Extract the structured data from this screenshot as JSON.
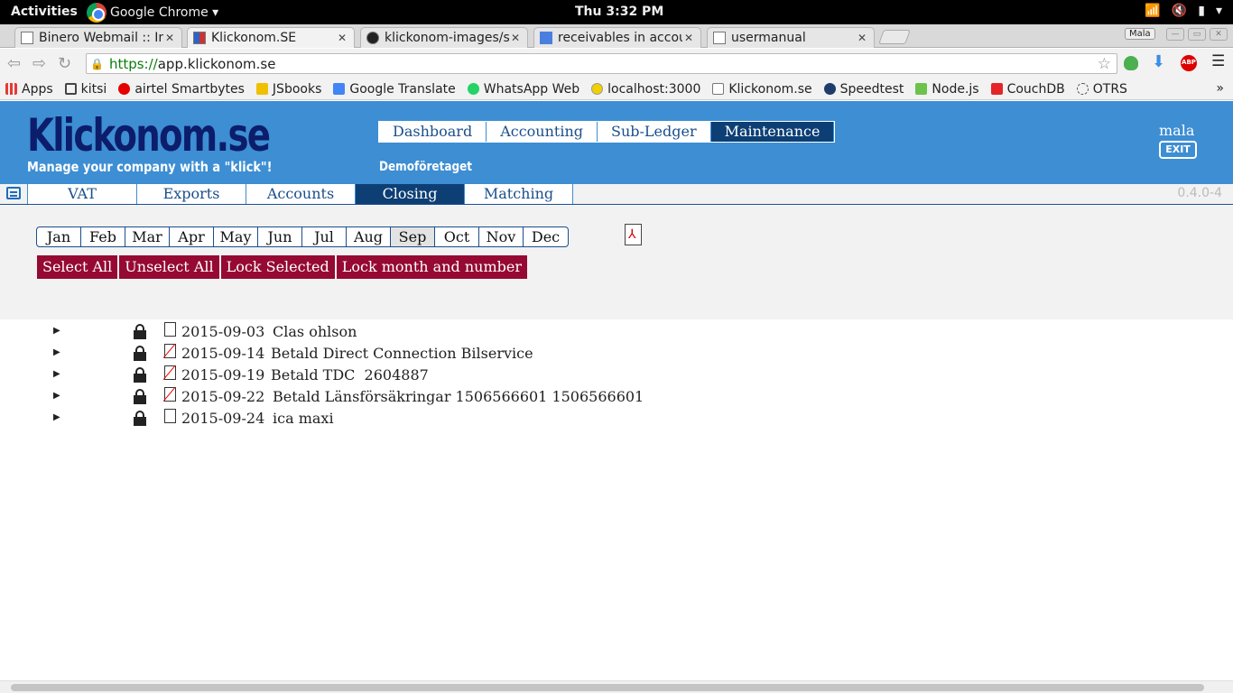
{
  "os": {
    "activities": "Activities",
    "app_menu": "Google Chrome ▾",
    "clock": "Thu  3:32 PM",
    "tray": [
      "wifi-icon",
      "volume-muted-icon",
      "battery-icon",
      "power-menu-icon"
    ]
  },
  "browser": {
    "tabs": [
      {
        "title": "Binero Webmail :: Int",
        "active": false
      },
      {
        "title": "Klickonom.SE",
        "active": true
      },
      {
        "title": "klickonom-images/su",
        "active": false
      },
      {
        "title": "receivables in accour",
        "active": false
      },
      {
        "title": "usermanual",
        "active": false
      }
    ],
    "tab_close": "✕",
    "profile_badge": "Mala",
    "url_scheme": "https://",
    "url_host": "app.klickonom.se",
    "extensions": [
      "evernote-icon",
      "download-icon",
      "adblock-plus-icon",
      "menu-icon"
    ],
    "adblock_label": "ABP",
    "bookmarks": [
      {
        "label": "Apps",
        "icon": "apps-grid-icon",
        "color": "#e53935"
      },
      {
        "label": "kitsi",
        "icon": "bookmark-icon",
        "color": "#444444"
      },
      {
        "label": "airtel Smartbytes",
        "icon": "airtel-icon",
        "color": "#e40000"
      },
      {
        "label": "JSbooks",
        "icon": "jsbooks-icon",
        "color": "#f0c000"
      },
      {
        "label": "Google Translate",
        "icon": "translate-icon",
        "color": "#4285f4"
      },
      {
        "label": "WhatsApp Web",
        "icon": "whatsapp-icon",
        "color": "#25d366"
      },
      {
        "label": "localhost:3000",
        "icon": "circle-icon",
        "color": "#f2d000"
      },
      {
        "label": "Klickonom.se",
        "icon": "page-icon",
        "color": "#ffffff"
      },
      {
        "label": "Speedtest",
        "icon": "speedtest-icon",
        "color": "#1f3c6b"
      },
      {
        "label": "Node.js",
        "icon": "nodejs-icon",
        "color": "#6cc24a"
      },
      {
        "label": "CouchDB",
        "icon": "couchdb-icon",
        "color": "#e42528"
      },
      {
        "label": "OTRS",
        "icon": "otrs-icon",
        "color": "#555555"
      }
    ],
    "bookmarks_more": "»"
  },
  "app": {
    "logo": "Klickonom.se",
    "tagline": "Manage your company with a \"klick\"!",
    "main_nav": [
      {
        "label": "Dashboard",
        "active": false
      },
      {
        "label": "Accounting",
        "active": false
      },
      {
        "label": "Sub-Ledger",
        "active": false
      },
      {
        "label": "Maintenance",
        "active": true
      }
    ],
    "company": "Demoföretaget",
    "user": "mala",
    "exit_label": "EXIT",
    "sub_nav": [
      {
        "label": "VAT",
        "active": false
      },
      {
        "label": "Exports",
        "active": false
      },
      {
        "label": "Accounts",
        "active": false
      },
      {
        "label": "Closing",
        "active": true
      },
      {
        "label": "Matching",
        "active": false
      }
    ],
    "version": "0.4.0-4",
    "months": [
      {
        "label": "Jan",
        "active": false
      },
      {
        "label": "Feb",
        "active": false
      },
      {
        "label": "Mar",
        "active": false
      },
      {
        "label": "Apr",
        "active": false
      },
      {
        "label": "May",
        "active": false
      },
      {
        "label": "Jun",
        "active": false
      },
      {
        "label": "Jul",
        "active": false
      },
      {
        "label": "Aug",
        "active": false
      },
      {
        "label": "Sep",
        "active": true
      },
      {
        "label": "Oct",
        "active": false
      },
      {
        "label": "Nov",
        "active": false
      },
      {
        "label": "Dec",
        "active": false
      }
    ],
    "actions": {
      "select_all": "Select All",
      "unselect_all": "Unselect All",
      "lock_selected": "Lock Selected",
      "lock_month": "Lock month and number"
    },
    "vouchers": [
      {
        "date": "2015-09-03",
        "description": "Clas ohlson",
        "attachment": false
      },
      {
        "date": "2015-09-14",
        "description": "Betald Direct Connection Bilservice",
        "attachment": true
      },
      {
        "date": "2015-09-19",
        "description": "Betald TDC  2604887",
        "attachment": true
      },
      {
        "date": "2015-09-22",
        "description": "Betald Länsförsäkringar 1506566601 1506566601",
        "attachment": true
      },
      {
        "date": "2015-09-24",
        "description": "ica maxi",
        "attachment": false
      }
    ],
    "colors": {
      "header_bg": "#3d8ed3",
      "logo": "#0c1d6b",
      "nav_active": "#0d3f75",
      "action_button": "#950933"
    }
  }
}
